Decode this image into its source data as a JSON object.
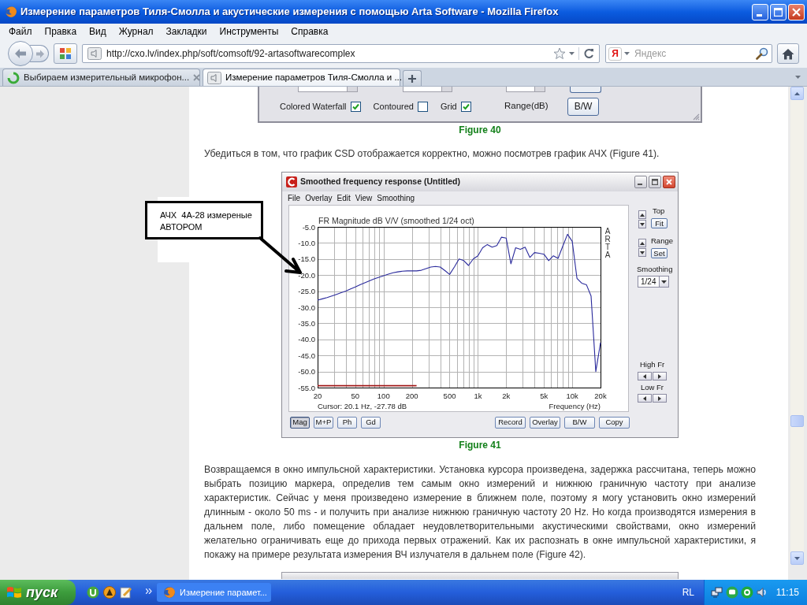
{
  "window": {
    "title": "Измерение параметров Тиля-Смолла и акустические измерения с помощью Arta Software - Mozilla Firefox"
  },
  "menu": [
    "Файл",
    "Правка",
    "Вид",
    "Журнал",
    "Закладки",
    "Инструменты",
    "Справка"
  ],
  "address_bar": {
    "url": "http://cxo.lv/index.php/soft/comsoft/92-artasoftwarecomplex"
  },
  "search": {
    "logo": "Я",
    "placeholder": "Яндекс"
  },
  "tabs": [
    {
      "label": "Выбираем измерительный микрофон...",
      "selected": false,
      "loading": true
    },
    {
      "label": "Измерение параметров Тиля-Смолла и ...",
      "selected": true,
      "loading": false
    }
  ],
  "figure_40": {
    "options": [
      {
        "label": "Colored Waterfall",
        "checked": true
      },
      {
        "label": "Contoured",
        "checked": false
      },
      {
        "label": "Grid",
        "checked": true
      }
    ],
    "range_label": "Range(dB)",
    "button": "B/W",
    "caption": "Figure 40"
  },
  "paragraph_1": "Убедиться в том, что график CSD отображается корректно, можно посмотрев график АЧХ (Figure 41).",
  "annotation": {
    "lines": [
      "АЧХ  4А-28 измереные",
      "АВТОРОМ"
    ]
  },
  "figure_41": {
    "title": "Smoothed frequency response (Untitled)",
    "menu": [
      "File",
      "Overlay",
      "Edit",
      "View",
      "Smoothing"
    ],
    "chart_data": {
      "type": "line",
      "title": "FR Magnitude dB V/V (smoothed 1/24 oct)",
      "xlabel": "Frequency (Hz)",
      "grid": true,
      "categories": [
        "20",
        null,
        null,
        null,
        null,
        null,
        null,
        null,
        "50",
        null,
        null,
        null,
        null,
        null,
        "100",
        null,
        null,
        null,
        null,
        null,
        "200",
        null,
        null,
        null,
        null,
        null,
        null,
        null,
        "500",
        null,
        null,
        null,
        null,
        null,
        "1k",
        null,
        null,
        null,
        null,
        null,
        "2k",
        null,
        null,
        null,
        null,
        null,
        null,
        null,
        "5k",
        null,
        null,
        null,
        null,
        null,
        "10k",
        null,
        null,
        null,
        null,
        null,
        "20k"
      ],
      "series": [
        {
          "color": "#2a2a9c",
          "values": [
            -27.8,
            -27.4,
            -27.0,
            -26.5,
            -26.0,
            -25.5,
            -25.0,
            -24.3,
            -23.7,
            -23.0,
            -22.4,
            -21.8,
            -21.2,
            -20.7,
            -20.2,
            -19.7,
            -19.3,
            -19.0,
            -18.8,
            -18.7,
            -18.7,
            -18.7,
            -18.5,
            -18.0,
            -17.5,
            -17.3,
            -17.5,
            -18.6,
            -19.8,
            -17.5,
            -15.0,
            -15.5,
            -17.0,
            -15.0,
            -14.0,
            -11.5,
            -10.5,
            -11.3,
            -10.8,
            -8.2,
            -8.5,
            -16.5,
            -11.5,
            -12.0,
            -11.3,
            -14.5,
            -13.0,
            -13.2,
            -13.5,
            -15.5,
            -14.0,
            -14.8,
            -11.0,
            -7.3,
            -9.5,
            -21.0,
            -22.5,
            -23.0,
            -26.5,
            -50.0,
            -41.0
          ]
        },
        {
          "color": "#a01818",
          "values": [
            -54.4,
            -54.4,
            -54.4,
            -54.4,
            -54.4,
            -54.4,
            -54.4,
            -54.4,
            -54.4,
            -54.4,
            -54.4,
            -54.4,
            -54.4,
            -54.4,
            -54.4,
            -54.4,
            -54.4,
            -54.4,
            -54.4,
            -54.4,
            -54.4,
            -54.4,
            null,
            null,
            null,
            null,
            null,
            null,
            null,
            null,
            null,
            null,
            null,
            null,
            null,
            null,
            null,
            null,
            null,
            null,
            null,
            null,
            null,
            null,
            null,
            null,
            null,
            null,
            null,
            null,
            null,
            null,
            null,
            null,
            null,
            null,
            null,
            null,
            null,
            null,
            null
          ]
        }
      ],
      "ylim": [
        -55,
        -5
      ],
      "yticks": [
        {
          "value": -5,
          "label": "-5.0"
        },
        {
          "value": -10,
          "label": "-10.0"
        },
        {
          "value": -15,
          "label": "-15.0"
        },
        {
          "value": -20,
          "label": "-20.0"
        },
        {
          "value": -25,
          "label": "-25.0"
        },
        {
          "value": -30,
          "label": "-30.0"
        },
        {
          "value": -35,
          "label": "-35.0"
        },
        {
          "value": -40,
          "label": "-40.0"
        },
        {
          "value": -45,
          "label": "-45.0"
        },
        {
          "value": -50,
          "label": "-50.0"
        },
        {
          "value": -55,
          "label": "-55.0"
        }
      ]
    },
    "side_label": "ARTA",
    "cursor_readout": "Cursor: 20.1 Hz, -27.78 dB",
    "panel": {
      "top_label": "Top",
      "fit_button": "Fit",
      "range_label": "Range",
      "set_button": "Set",
      "smoothing_label": "Smoothing",
      "smoothing_value": "1/24",
      "high_label": "High Fr",
      "low_label": "Low Fr"
    },
    "view_buttons": [
      {
        "label": "Mag",
        "selected": true
      },
      {
        "label": "M+P",
        "selected": false
      },
      {
        "label": "Ph",
        "selected": false
      },
      {
        "label": "Gd",
        "selected": false
      }
    ],
    "action_buttons": [
      "Record",
      "Overlay",
      "B/W",
      "Copy"
    ],
    "caption": "Figure 41"
  },
  "paragraph_2": "Возвращаемся в окно импульсной характеристики. Установка курсора произведена, задержка рассчитана, теперь можно выбрать позицию маркера, определив тем самым окно измерений и нижнюю граничную частоту при анализе характеристик. Сейчас у меня произведено измерение в ближнем поле, поэтому я могу установить окно измерений длинным - около 50 ms - и получить при анализе нижнюю граничную частоту 20 Hz. Но когда производятся измерения в дальнем поле, либо помещение обладает неудовлетворительными акустическими свойствами, окно измерений желательно ограничивать еще до прихода первых отражений. Как их распознать в окне импульсной характеристики, я покажу на примере результата измерения ВЧ излучателя в дальнем поле (Figure 42).",
  "taskbar": {
    "start": "пуск",
    "tasks": [
      {
        "label": "Измерение парамет...",
        "selected": false
      }
    ],
    "language": "RL",
    "clock": "11:15"
  }
}
